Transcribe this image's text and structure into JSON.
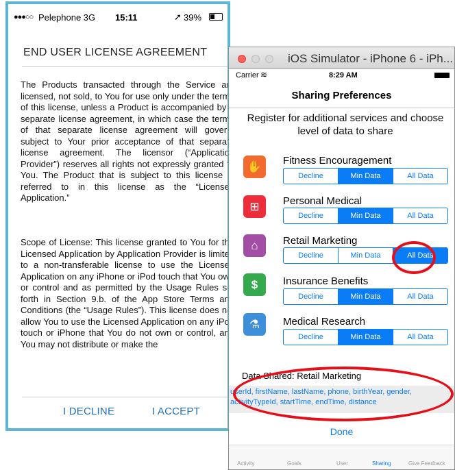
{
  "eula_phone": {
    "status": {
      "signal": "●●●○○",
      "carrier": "Pelephone 3G",
      "time": "15:11",
      "location": "➚",
      "battery": "39%"
    },
    "title": "END USER LICENSE AGREEMENT",
    "paragraph1": "The Products transacted through the Service are licensed, not sold, to You for use only under the terms of this license, unless a Product is accompanied by a separate license agreement, in which case the terms of that separate license agreement will govern, subject to Your prior acceptance of that separate license agreement. The licensor (“Application Provider”) reserves all rights not expressly granted to You. The Product that is subject to this license is referred to in this license as the “Licensed Application.”",
    "paragraph2": "Scope of License: This license granted to You for the Licensed Application by Application Provider is limited to a non-transferable license to use the Licensed Application on any iPhone or iPod touch that You own or control and as permitted by the Usage Rules set forth in Section 9.b. of the App Store Terms and Conditions (the “Usage Rules”). This license does not allow You to use the Licensed Application on any iPod touch or iPhone that You do not own or control, and You may not distribute or make the",
    "decline_label": "I DECLINE",
    "accept_label": "I ACCEPT"
  },
  "simulator": {
    "window_title": "iOS Simulator - iPhone 6 - iPh...",
    "status": {
      "carrier": "Carrier",
      "wifi": "≋",
      "time": "8:29 AM"
    },
    "nav_title": "Sharing Preferences",
    "intro": "Register for additional services and choose level of data to share",
    "segment_options": [
      "Decline",
      "Min Data",
      "All Data"
    ],
    "categories": [
      {
        "label": "Fitness Encouragement",
        "icon": "clapping-hands-icon",
        "glyph": "✋",
        "color": "#f26a2e",
        "selected": "Min Data"
      },
      {
        "label": "Personal Medical",
        "icon": "medical-kit-icon",
        "glyph": "⊞",
        "color": "#ee2d3b",
        "selected": "Min Data"
      },
      {
        "label": "Retail Marketing",
        "icon": "shopping-basket-icon",
        "glyph": "⌂",
        "color": "#a24ea4",
        "selected": "All Data"
      },
      {
        "label": "Insurance Benefits",
        "icon": "dollar-shield-icon",
        "glyph": "$",
        "color": "#35a94e",
        "selected": "Min Data"
      },
      {
        "label": "Medical Research",
        "icon": "lab-flask-icon",
        "glyph": "⚗",
        "color": "#3d8fd9",
        "selected": "Min Data"
      }
    ],
    "data_shared_title": "Data Shared: Retail Marketing",
    "data_shared_fields": "userId, firstName, lastName, phone, birthYear, gender, activityTypeId, startTime, endTime, distance",
    "done_label": "Done",
    "tabs": [
      "Activity",
      "Goals",
      "User",
      "Sharing",
      "Give Feedback"
    ],
    "active_tab": "Sharing"
  },
  "annotation_color": "#e3101a"
}
